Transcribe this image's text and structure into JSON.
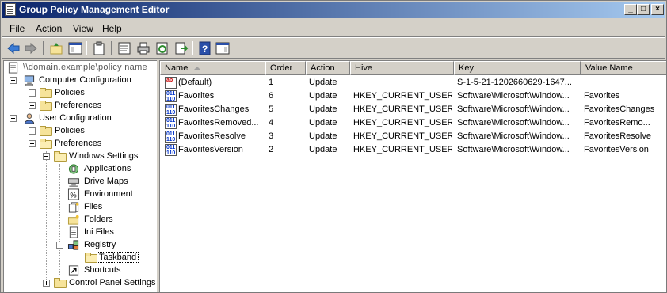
{
  "window": {
    "title": "Group Policy Management Editor"
  },
  "menu": [
    "File",
    "Action",
    "View",
    "Help"
  ],
  "toolbar": {
    "icons": [
      "back-arrow-icon",
      "forward-arrow-icon",
      "up-folder-icon",
      "show-hide-tree-icon",
      "clipboard-icon",
      "properties-icon",
      "print-icon",
      "refresh-icon",
      "export-list-icon",
      "help-icon",
      "console-pane-icon"
    ]
  },
  "tree": {
    "root": "\\\\domain.example\\policy name",
    "computer_configuration": "Computer Configuration",
    "cc_policies": "Policies",
    "cc_preferences": "Preferences",
    "user_configuration": "User Configuration",
    "uc_policies": "Policies",
    "uc_preferences": "Preferences",
    "windows_settings": "Windows Settings",
    "applications": "Applications",
    "drive_maps": "Drive Maps",
    "environment": "Environment",
    "files": "Files",
    "folders": "Folders",
    "ini_files": "Ini Files",
    "registry": "Registry",
    "taskband": "Taskband",
    "shortcuts": "Shortcuts",
    "control_panel_settings": "Control Panel Settings"
  },
  "list": {
    "columns": [
      "Name",
      "Order",
      "Action",
      "Hive",
      "Key",
      "Value Name"
    ],
    "rows": [
      {
        "icon": "ab",
        "name": "(Default)",
        "order": "1",
        "action": "Update",
        "hive": "",
        "key": "S-1-5-21-1202660629-1647...",
        "value_name": ""
      },
      {
        "icon": "bin",
        "name": "Favorites",
        "order": "6",
        "action": "Update",
        "hive": "HKEY_CURRENT_USER",
        "key": "Software\\Microsoft\\Window...",
        "value_name": "Favorites"
      },
      {
        "icon": "bin",
        "name": "FavoritesChanges",
        "order": "5",
        "action": "Update",
        "hive": "HKEY_CURRENT_USER",
        "key": "Software\\Microsoft\\Window...",
        "value_name": "FavoritesChanges"
      },
      {
        "icon": "bin",
        "name": "FavoritesRemoved...",
        "order": "4",
        "action": "Update",
        "hive": "HKEY_CURRENT_USER",
        "key": "Software\\Microsoft\\Window...",
        "value_name": "FavoritesRemo..."
      },
      {
        "icon": "bin",
        "name": "FavoritesResolve",
        "order": "3",
        "action": "Update",
        "hive": "HKEY_CURRENT_USER",
        "key": "Software\\Microsoft\\Window...",
        "value_name": "FavoritesResolve"
      },
      {
        "icon": "bin",
        "name": "FavoritesVersion",
        "order": "2",
        "action": "Update",
        "hive": "HKEY_CURRENT_USER",
        "key": "Software\\Microsoft\\Window...",
        "value_name": "FavoritesVersion"
      }
    ]
  },
  "colors": {
    "titlebar_start": "#0a246a",
    "titlebar_end": "#a6caf0",
    "chrome": "#d4d0c8"
  }
}
